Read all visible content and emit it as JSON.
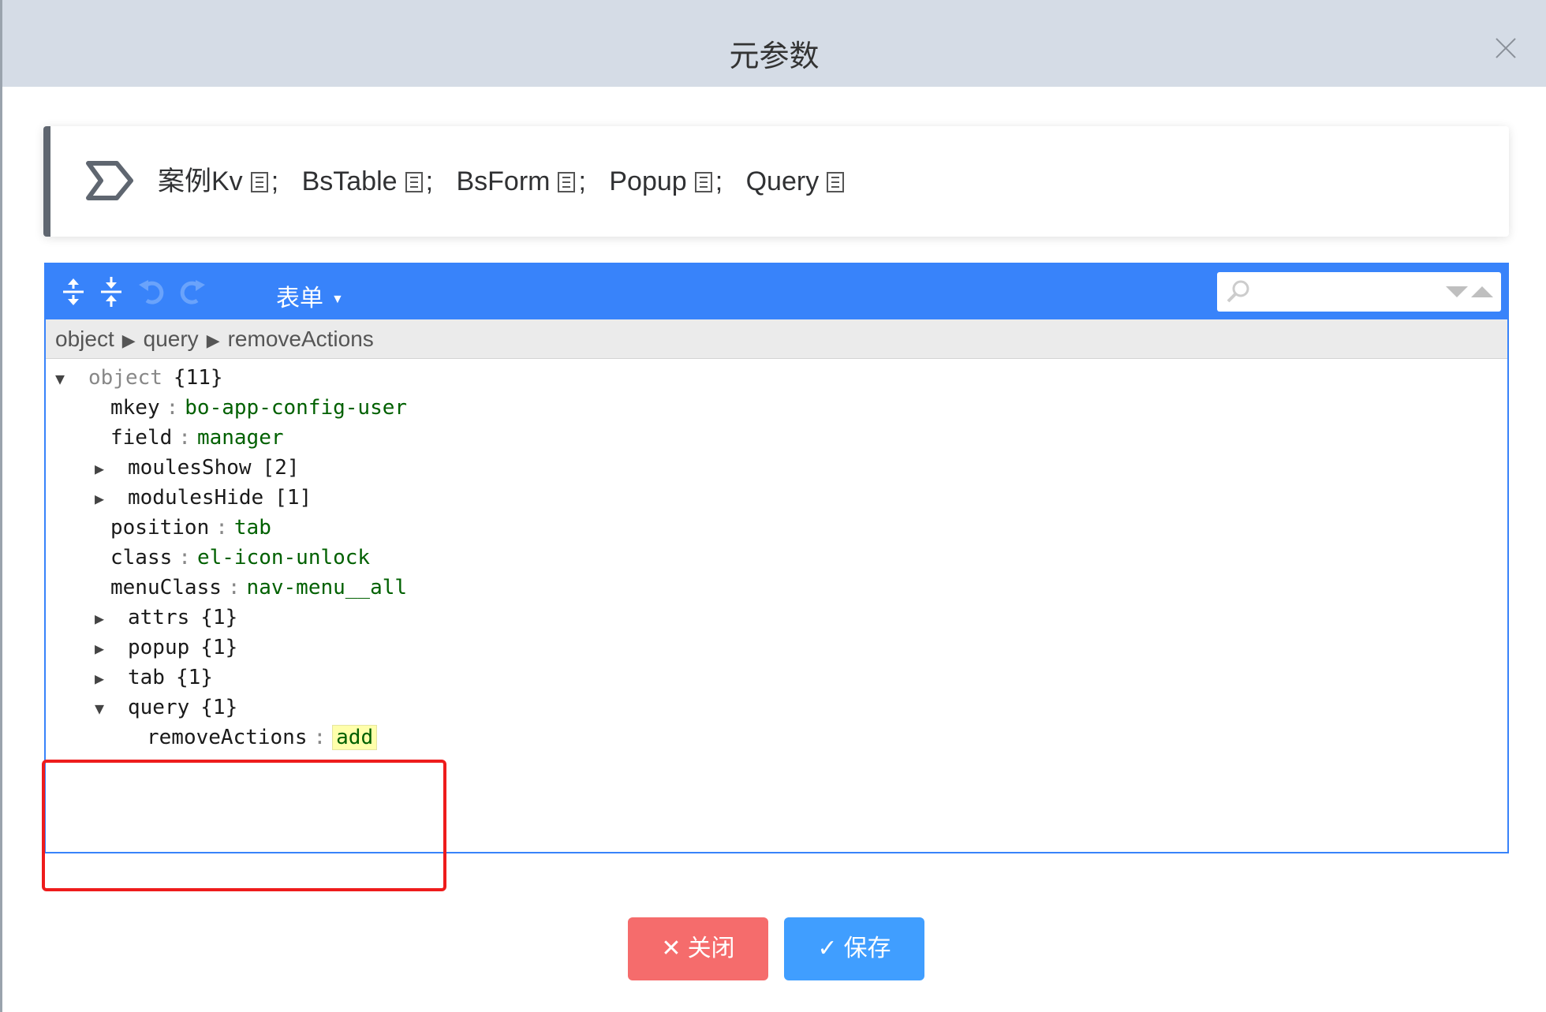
{
  "dialog": {
    "title": "元参数"
  },
  "keys": [
    {
      "label": "案例Kv",
      "sep": ";"
    },
    {
      "label": "BsTable",
      "sep": ";"
    },
    {
      "label": "BsForm",
      "sep": ";"
    },
    {
      "label": "Popup",
      "sep": ";"
    },
    {
      "label": "Query",
      "sep": ""
    }
  ],
  "toolbar": {
    "mode_label": "表单",
    "search_placeholder": ""
  },
  "breadcrumb": [
    "object",
    "query",
    "removeActions"
  ],
  "tree": {
    "root": {
      "key": "object",
      "count": "{11}"
    },
    "rows": [
      {
        "key": "mkey",
        "value": "bo-app-config-user"
      },
      {
        "key": "field",
        "value": "manager"
      },
      {
        "key": "moulesShow",
        "count": "[2]"
      },
      {
        "key": "modulesHide",
        "count": "[1]"
      },
      {
        "key": "position",
        "value": "tab"
      },
      {
        "key": "class",
        "value": "el-icon-unlock"
      },
      {
        "key": "menuClass",
        "value": "nav-menu__all"
      },
      {
        "key": "attrs",
        "count": "{1}"
      },
      {
        "key": "popup",
        "count": "{1}"
      },
      {
        "key": "tab",
        "count": "{1}"
      },
      {
        "key": "query",
        "count": "{1}"
      },
      {
        "key": "removeActions",
        "value": "add"
      }
    ],
    "colon": ":"
  },
  "buttons": {
    "close_label": "关闭",
    "save_label": "保存"
  },
  "colors": {
    "accent": "#3883fa",
    "danger": "#f56c6c",
    "primary": "#409eff",
    "highlight_box": "#ee1c1c"
  }
}
